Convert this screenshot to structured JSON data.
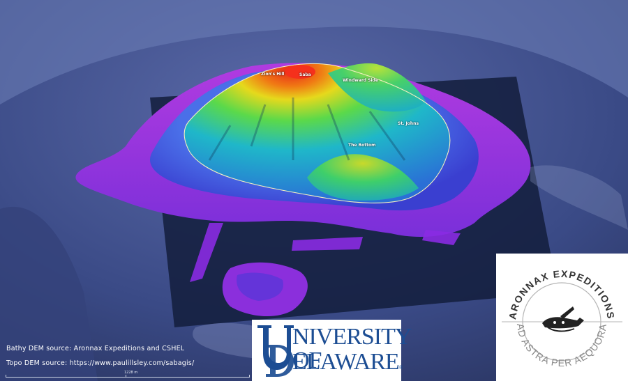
{
  "map": {
    "places": [
      {
        "name": "Zion's Hill"
      },
      {
        "name": "Saba"
      },
      {
        "name": "Windward Side"
      },
      {
        "name": "St. Johns"
      },
      {
        "name": "The Bottom"
      }
    ],
    "scale_label": "1228 m",
    "colors": {
      "sea": "#2a3660",
      "deep": "#8a2be2",
      "shallow": "#3a5bdc",
      "land_low": "#1fb7c9",
      "land_mid": "#5bd94a",
      "land_high": "#e8261a"
    }
  },
  "caption": {
    "bathy_source": "Bathy DEM source: Aronnax Expeditions and CSHEL",
    "topo_source": "Topo DEM source: https://www.paulillsley.com/sabagis/"
  },
  "logos": {
    "university": {
      "line1": "NIVERSITY OF",
      "line2": "ELAWARE",
      "mark": "UD",
      "registered": "®"
    },
    "aronnax": {
      "ring_text": "ARONNAX EXPEDITIONS",
      "motto": "AD ASTRA PER AEQUORA"
    }
  }
}
